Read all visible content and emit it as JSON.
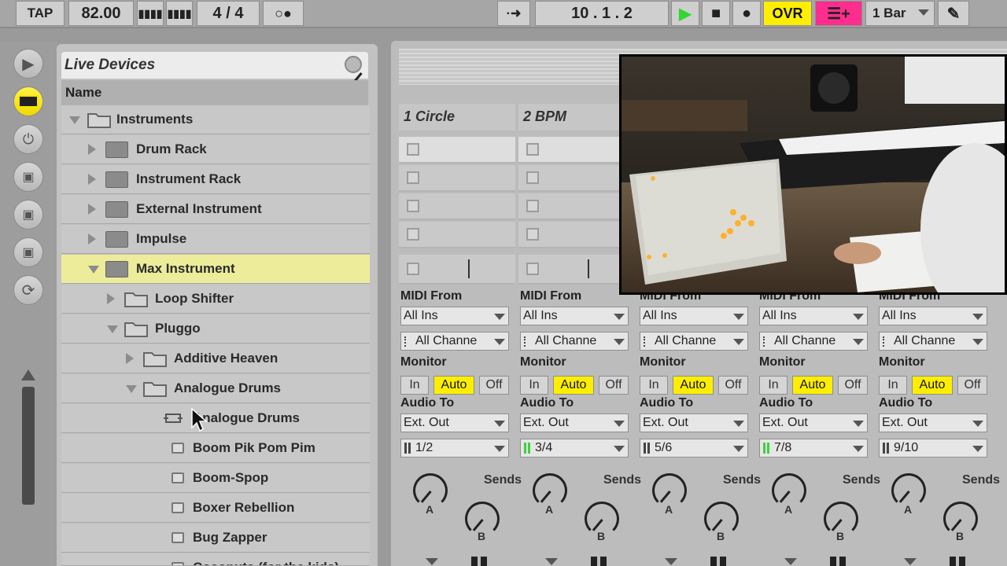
{
  "transport": {
    "tap": "TAP",
    "tempo": "82.00",
    "time_sig": "4  /  4",
    "position": "10 .  1 .  2",
    "ovr": "OVR",
    "quantize": "1 Bar"
  },
  "browser": {
    "title": "Live Devices",
    "column": "Name",
    "rows": [
      {
        "label": "Instruments"
      },
      {
        "label": "Drum Rack"
      },
      {
        "label": "Instrument Rack"
      },
      {
        "label": "External Instrument"
      },
      {
        "label": "Impulse"
      },
      {
        "label": "Max Instrument"
      },
      {
        "label": "Loop Shifter"
      },
      {
        "label": "Pluggo"
      },
      {
        "label": "Additive Heaven"
      },
      {
        "label": "Analogue Drums"
      },
      {
        "label": "Analogue Drums"
      },
      {
        "label": "Boom Pik Pom Pim"
      },
      {
        "label": "Boom-Spop"
      },
      {
        "label": "Boxer Rebellion"
      },
      {
        "label": "Bug Zapper"
      },
      {
        "label": "Coconuts (for the kids)"
      }
    ]
  },
  "tracks": [
    {
      "name": "1 Circle",
      "midi_from": "All Ins",
      "channel": "All Channe",
      "audio_to": "Ext. Out",
      "out_ch": "1/2"
    },
    {
      "name": "2 BPM",
      "midi_from": "All Ins",
      "channel": "All Channe",
      "audio_to": "Ext. Out",
      "out_ch": "3/4"
    },
    {
      "name": "",
      "midi_from": "All Ins",
      "channel": "All Channe",
      "audio_to": "Ext. Out",
      "out_ch": "5/6"
    },
    {
      "name": "",
      "midi_from": "All Ins",
      "channel": "All Channe",
      "audio_to": "Ext. Out",
      "out_ch": "7/8"
    },
    {
      "name": "",
      "midi_from": "All Ins",
      "channel": "All Channe",
      "audio_to": "Ext. Out",
      "out_ch": "9/10"
    }
  ],
  "io_labels": {
    "midi_from": "MIDI From",
    "monitor": "Monitor",
    "audio_to": "Audio To",
    "in": "In",
    "auto": "Auto",
    "off": "Off",
    "sends": "Sends",
    "a": "A",
    "b": "B"
  },
  "colors": {
    "accent_yellow": "#ffee00",
    "pink": "#ff2d8e",
    "play_green": "#32d632",
    "selected_row": "#ecec9a"
  }
}
